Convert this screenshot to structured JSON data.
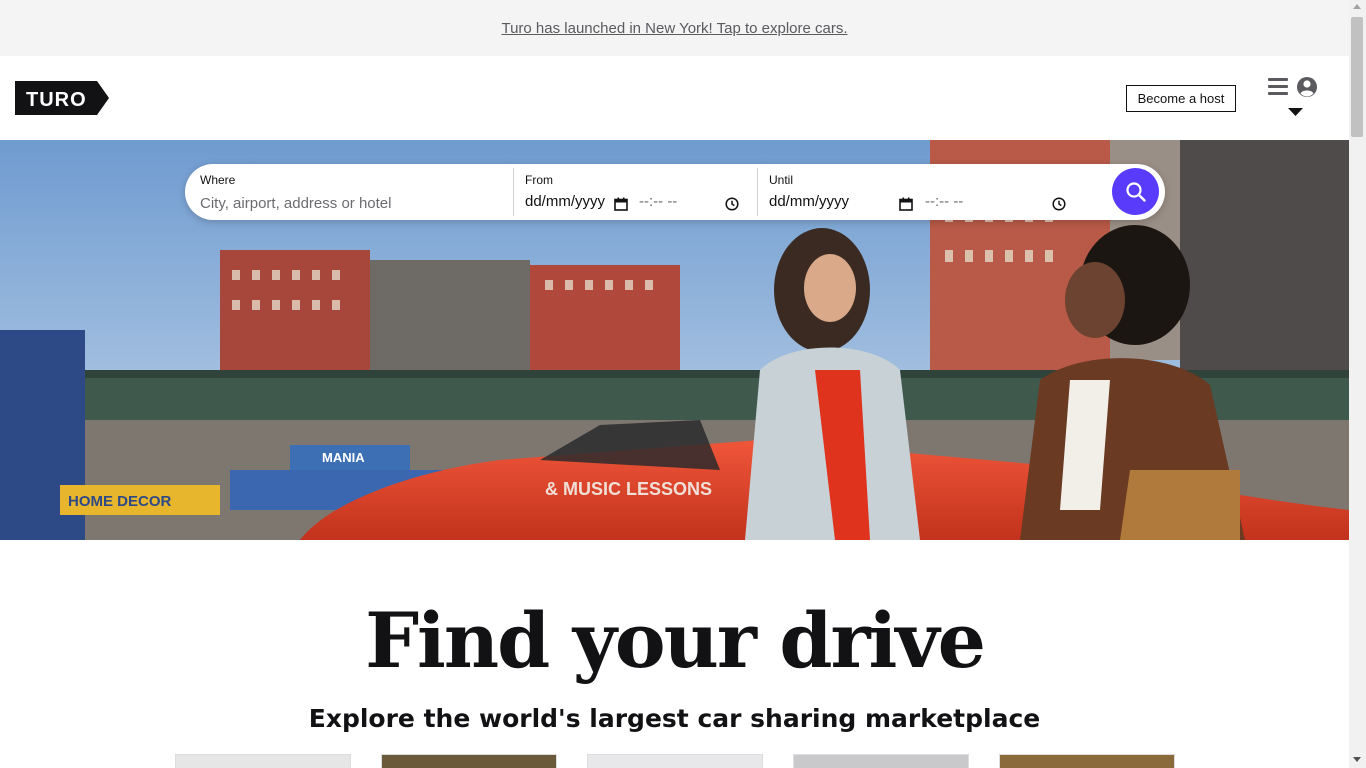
{
  "banner": {
    "text": "Turo has launched in New York! Tap to explore cars."
  },
  "header": {
    "logo_text": "TURO",
    "become_host": "Become a host",
    "icons": [
      "hamburger-icon",
      "account-icon",
      "caret-down-icon"
    ]
  },
  "search": {
    "where_label": "Where",
    "where_placeholder": "City, airport, address or hotel",
    "from_label": "From",
    "from_date": "dd/mm/yyyy",
    "from_time": "--:-- --",
    "until_label": "Until",
    "until_date": "dd/mm/yyyy",
    "until_time": "--:-- --",
    "button_icon": "search-icon",
    "accent_color": "#593cfb"
  },
  "hero": {
    "signs": {
      "lessons": "& MUSIC LESSONS",
      "decor": "HOME DECOR",
      "mania": "MANIA"
    }
  },
  "main": {
    "headline": "Find your drive",
    "subheadline": "Explore the world's largest car sharing marketplace"
  },
  "colors": {
    "brand_black": "#121214",
    "accent": "#593cfb",
    "banner_bg": "#f4f4f4"
  }
}
